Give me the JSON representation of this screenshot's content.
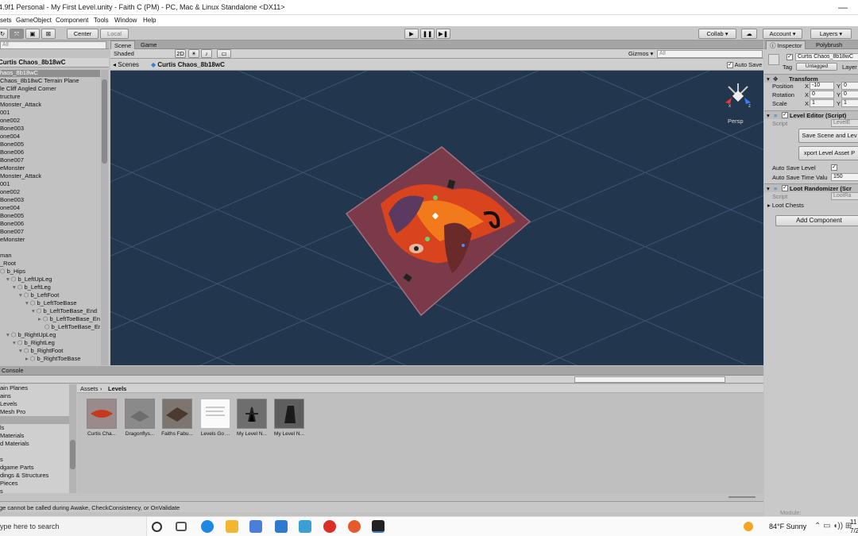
{
  "window": {
    "title": "4.9f1 Personal - My First Level.unity - Faith C (PM) - PC, Mac & Linux Standalone <DX11>",
    "minimize": "—",
    "maximize": "☐",
    "close": "✕"
  },
  "menu": [
    "sets",
    "GameObject",
    "Component",
    "Tools",
    "Window",
    "Help"
  ],
  "toolbar": {
    "center": "Center",
    "local": "Local",
    "collab": "Collab ▾",
    "account": "Account ▾",
    "layers": "Layers ▾",
    "play": "▶",
    "pause": "❚❚",
    "step": "▶❚"
  },
  "hierarchy": {
    "search_placeholder": "All",
    "root": "Curtis Chaos_8b18wC",
    "rows": [
      "haos_8b18wC",
      "Chaos_8b18wC Terrain Plane",
      "le Cliff Angled Corner",
      "tructure",
      "Monster_Attack",
      "001",
      "one002",
      "Bone003",
      "one004",
      "Bone005",
      "Bone006",
      "Bone007",
      "eMonster",
      "Monster_Attack",
      "001",
      "one002",
      "Bone003",
      "one004",
      "Bone005",
      "Bone006",
      "Bone007",
      "eMonster",
      "",
      "man",
      "_Root",
      "b_Hips",
      "b_LeftUpLeg",
      "b_LeftLeg",
      "b_LeftFoot",
      "b_LeftToeBase",
      "b_LeftToeBase_End",
      "b_LeftToeBase_End_",
      "b_LeftToeBase_Er",
      "b_RightUpLeg",
      "b_RightLeg",
      "b_RightFoot",
      "b_RightToeBase"
    ]
  },
  "scene_view": {
    "tab_scene": "Scene",
    "tab_game": "Game",
    "shading": "Shaded",
    "mode_2d": "2D",
    "gizmos": "Gizmos ▾",
    "search_placeholder": "All",
    "breadcrumb_root": "Scenes",
    "breadcrumb_item": "Curtis Chaos_8b18wC",
    "autosave": "Auto Save",
    "persp": "Persp",
    "axis_x": "x",
    "axis_z": "z",
    "colors": {
      "background": "#22364e",
      "plane": "#7a3a4a"
    }
  },
  "console": {
    "tab": "Console"
  },
  "project": {
    "left_items": [
      "ain Planes",
      "ains",
      "Levels",
      "Mesh Pro",
      "",
      "ls",
      "Materials",
      "d Materials",
      "",
      "s",
      "dgame Parts",
      "dings & Structures",
      "Pieces",
      "s"
    ],
    "breadcrumb": [
      "Assets",
      "Levels"
    ],
    "assets": [
      "Curtis Cha...",
      "Dragonflys...",
      "Faiths Fabu...",
      "Levels Go ...",
      "My Level N...",
      "My Level N..."
    ]
  },
  "status": {
    "message": "ge cannot be called during Awake, CheckConsistency, or OnValidate"
  },
  "inspector": {
    "tab_inspector": "Inspector",
    "tab_polybrush": "Polybrush",
    "object_name": "Curtis Chaos_8b18wC",
    "tag_label": "Tag",
    "tag_value": "Untagged",
    "layer_label": "Layer",
    "transform": {
      "title": "Transform",
      "position": "Position",
      "rotation": "Rotation",
      "scale": "Scale",
      "pos_x": "-10",
      "pos_y": "0",
      "rot_x": "0",
      "rot_y": "0",
      "scl_x": "1",
      "scl_y": "1"
    },
    "level_editor": {
      "title": "Level Editor (Script)",
      "script_label": "Script",
      "script_value": "LevelE",
      "btn_save": "Save Scene and Lev",
      "btn_export": "xport Level Asset P",
      "autosave_label": "Auto Save Level",
      "autosave_time_label": "Auto Save Time Valu",
      "autosave_time": "150"
    },
    "loot": {
      "title": "Loot Randomizer (Scr",
      "script_label": "Script",
      "script_value": "LootRa",
      "chests": "Loot Chests"
    },
    "add_component": "Add Component",
    "module": "Module:"
  },
  "taskbar": {
    "search": "ype here to search",
    "weather": "84°F  Sunny",
    "time": "11",
    "date": "7/2"
  }
}
